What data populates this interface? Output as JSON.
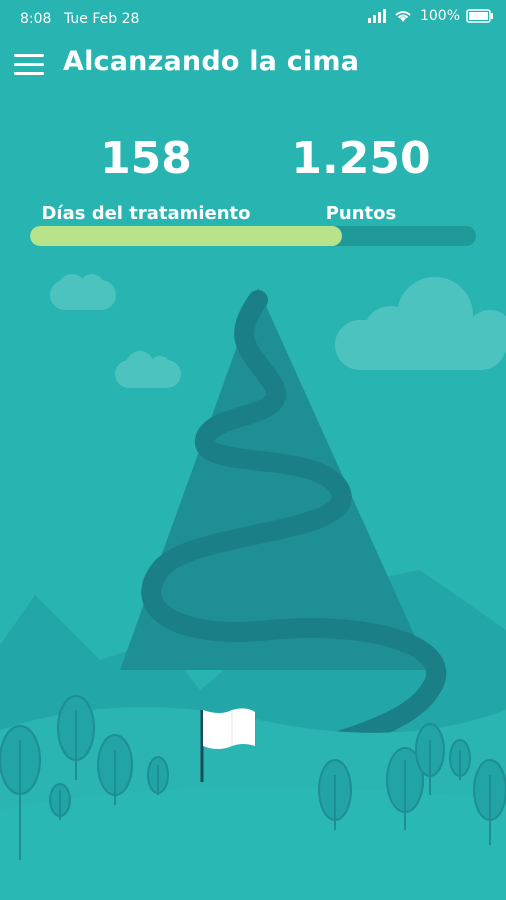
{
  "status_bar": {
    "time": "8:08",
    "date": "Tue Feb 28",
    "battery": "100%"
  },
  "header": {
    "title": "Alcanzando la cima",
    "menu_icon": "hamburger-icon"
  },
  "stats": {
    "days_value": "158",
    "days_label": "Días del tratamiento",
    "points_value": "1.250",
    "points_label": "Puntos"
  },
  "progress": {
    "fraction": 0.7
  },
  "colors": {
    "background": "#28b4b1",
    "progress_fill": "#b7e38a",
    "progress_track": "#1f9a98",
    "mountain": "#1f8f96",
    "flag": "#ffffff"
  }
}
